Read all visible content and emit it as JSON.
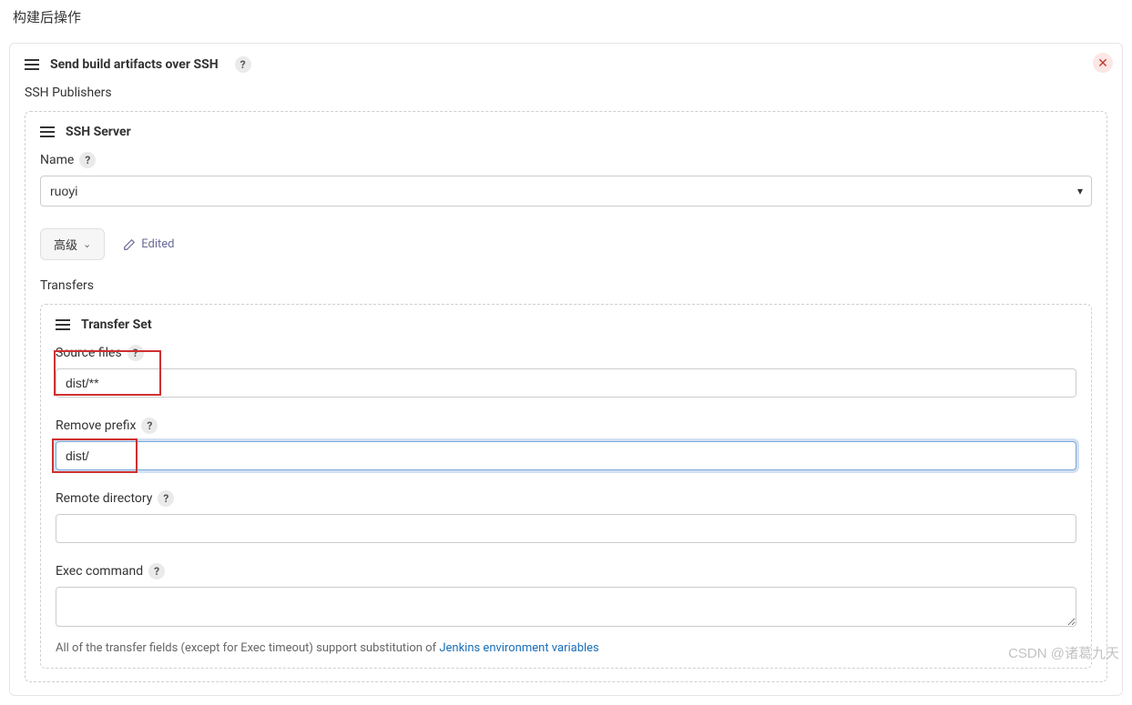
{
  "page": {
    "title": "构建后操作"
  },
  "artifact_panel": {
    "title": "Send build artifacts over SSH",
    "ssh_publishers_label": "SSH Publishers"
  },
  "ssh_server": {
    "title": "SSH Server",
    "name_label": "Name",
    "name_value": "ruoyi",
    "advanced_label": "高级",
    "edited_label": "Edited",
    "transfers_label": "Transfers"
  },
  "transfer_set": {
    "title": "Transfer Set",
    "source_files_label": "Source files",
    "source_files_value": "dist/**",
    "remove_prefix_label": "Remove prefix",
    "remove_prefix_value": "dist/",
    "remote_directory_label": "Remote directory",
    "remote_directory_value": "",
    "exec_command_label": "Exec command",
    "exec_command_value": ""
  },
  "footer": {
    "note_prefix": "All of the transfer fields (except for Exec timeout) support substitution of ",
    "link_text": "Jenkins environment variables"
  },
  "watermark": "CSDN @诸葛九天"
}
